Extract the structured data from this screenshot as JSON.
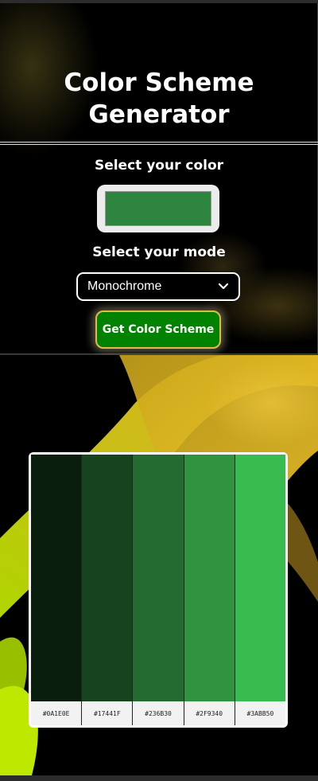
{
  "app": {
    "title": "Color Scheme Generator"
  },
  "controls": {
    "color_label": "Select your color",
    "selected_color": "#2E8540",
    "mode_label": "Select your mode",
    "mode_value": "Monochrome",
    "button_label": "Get Color Scheme"
  },
  "palette": {
    "colors": [
      {
        "hex": "#0A1E0E",
        "label": "#0A1E0E"
      },
      {
        "hex": "#17441F",
        "label": "#17441F"
      },
      {
        "hex": "#236B30",
        "label": "#236B30"
      },
      {
        "hex": "#2F9340",
        "label": "#2F9340"
      },
      {
        "hex": "#3ABB50",
        "label": "#3ABB50"
      }
    ]
  },
  "theme": {
    "button_color": "#018200",
    "button_border": "#E2B94B",
    "background": "#000000"
  }
}
